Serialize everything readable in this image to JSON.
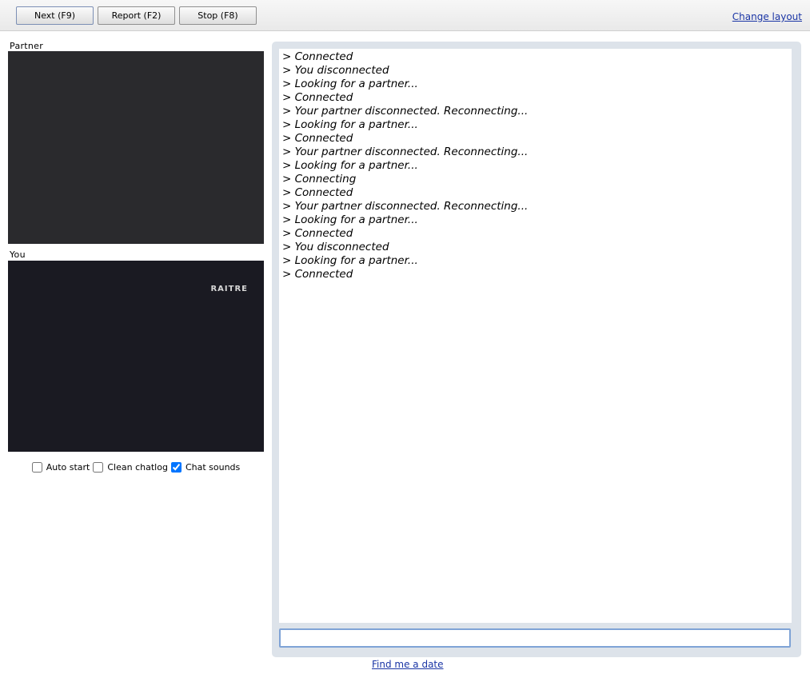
{
  "toolbar": {
    "next_label": "Next (F9)",
    "report_label": "Report (F2)",
    "stop_label": "Stop (F8)",
    "change_layout": "Change layout"
  },
  "videos": {
    "partner_label": "Partner",
    "you_label": "You",
    "you_watermark": "RAITRE"
  },
  "options": [
    {
      "label": "Auto start",
      "checked": false
    },
    {
      "label": "Clean chatlog",
      "checked": false
    },
    {
      "label": "Chat sounds",
      "checked": true
    }
  ],
  "chatlog": [
    "> Connected",
    "> You disconnected",
    "> Looking for a partner...",
    "> Connected",
    "> Your partner disconnected. Reconnecting...",
    "> Looking for a partner...",
    "> Connected",
    "> Your partner disconnected. Reconnecting...",
    "> Looking for a partner...",
    "> Connecting",
    "> Connected",
    "> Your partner disconnected. Reconnecting...",
    "> Looking for a partner...",
    "> Connected",
    "> You disconnected",
    "> Looking for a partner...",
    "> Connected"
  ],
  "chat_input": {
    "value": "",
    "placeholder": ""
  },
  "footer": {
    "find_date": "Find me a date"
  },
  "colors": {
    "link": "#1a35a5",
    "chat_frame": "#dde3ea",
    "input_border": "#7fa3d6"
  }
}
